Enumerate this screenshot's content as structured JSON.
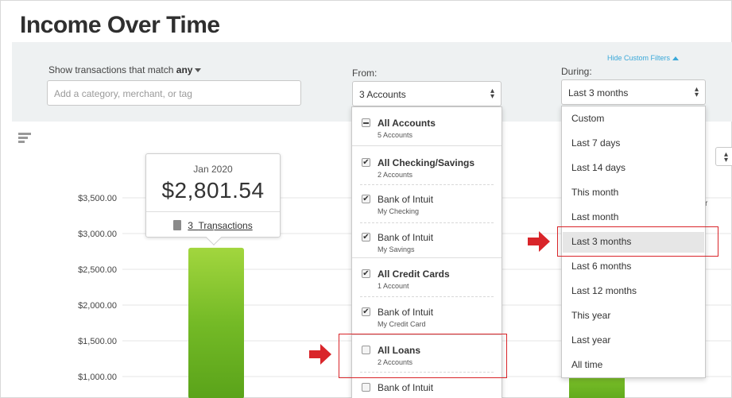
{
  "title": "Income Over Time",
  "filters": {
    "match_label": "Show transactions that match",
    "match_value": "any",
    "search_placeholder": "Add a category, merchant, or tag",
    "from_label": "From:",
    "from_value": "3 Accounts",
    "during_label": "During:",
    "during_value": "Last 3 months",
    "hide_filters_link": "Hide Custom Filters"
  },
  "chart_data": {
    "type": "bar",
    "categories": [
      "Jan 2020"
    ],
    "values": [
      2801.54
    ],
    "ytick_labels": [
      "$3,500.00",
      "$3,000.00",
      "$2,500.00",
      "$2,000.00",
      "$1,500.00",
      "$1,000.00"
    ],
    "ylim": [
      0,
      3500
    ],
    "grid": true,
    "bar_color": "#72b925"
  },
  "tooltip": {
    "date": "Jan 2020",
    "amount": "$2,801.54",
    "transactions_count": "3",
    "transactions_label": "Transactions"
  },
  "accounts_dropdown": [
    {
      "name": "All Accounts",
      "sub": "5 Accounts",
      "bold": true,
      "state": "partial"
    },
    {
      "name": "All Checking/Savings",
      "sub": "2 Accounts",
      "bold": true,
      "state": "checked"
    },
    {
      "name": "Bank of Intuit",
      "sub": "My Checking",
      "bold": false,
      "state": "checked"
    },
    {
      "name": "Bank of Intuit",
      "sub": "My Savings",
      "bold": false,
      "state": "checked"
    },
    {
      "name": "All Credit Cards",
      "sub": "1 Account",
      "bold": true,
      "state": "checked"
    },
    {
      "name": "Bank of Intuit",
      "sub": "My Credit Card",
      "bold": false,
      "state": "checked"
    },
    {
      "name": "All Loans",
      "sub": "2 Accounts",
      "bold": true,
      "state": "unchecked"
    },
    {
      "name": "Bank of Intuit",
      "sub": "",
      "bold": false,
      "state": "unchecked"
    }
  ],
  "during_dropdown": {
    "options": [
      "Custom",
      "Last 7 days",
      "Last 14 days",
      "This month",
      "Last month",
      "Last 3 months",
      "Last 6 months",
      "Last 12 months",
      "This year",
      "Last year",
      "All time"
    ],
    "selected": "Last 3 months"
  },
  "side_partial_text": "r",
  "colors": {
    "accent_link": "#3aa8d9",
    "annotation_red": "#d9252a",
    "filter_bg": "#eef1f2"
  }
}
